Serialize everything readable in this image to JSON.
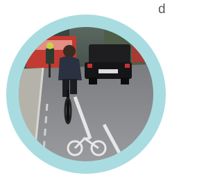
{
  "edge_fragment": "d",
  "ring_color": "#a9dce0"
}
